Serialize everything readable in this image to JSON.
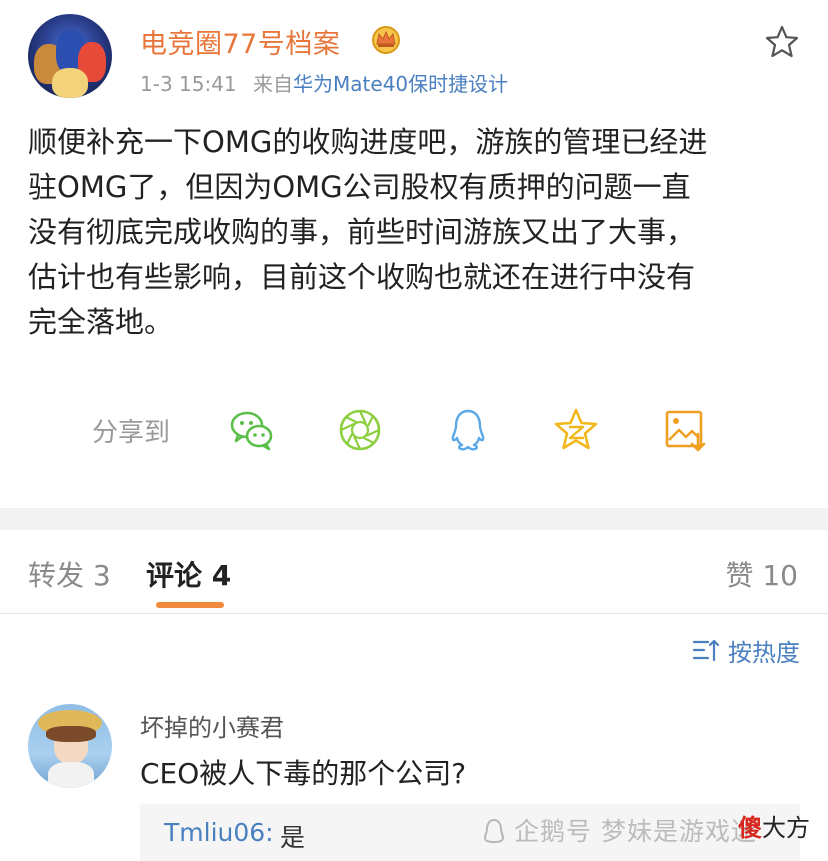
{
  "post": {
    "username": "电竞圈77号档案",
    "time": "1-3 15:41",
    "from_prefix": "来自",
    "source": "华为Mate40保时捷设计",
    "content_lines": [
      "顺便补充一下OMG的收购进度吧，游族的管理已经进",
      "驻OMG了，但因为OMG公司股权有质押的问题一直",
      "没有彻底完成收购的事，前些时间游族又出了大事，",
      "估计也有些影响，目前这个收购也就还在进行中没有",
      "完全落地。"
    ]
  },
  "share": {
    "label": "分享到",
    "icons": [
      "wechat-icon",
      "moments-icon",
      "qq-icon",
      "qzone-icon",
      "save-image-icon"
    ]
  },
  "tabs": {
    "repost": "转发 3",
    "comment": "评论 4",
    "like": "赞 10"
  },
  "sort": {
    "label": "按热度"
  },
  "comment": {
    "user": "坏掉的小赛君",
    "text": "CEO被人下毒的那个公司?",
    "reply_user": "Tmliu06:",
    "reply_text": "是"
  },
  "watermark": {
    "text": "企鹅号 梦妹是游戏迷",
    "corner_red": "傻",
    "corner_black": "大方"
  },
  "colors": {
    "username": "#e8763a",
    "link": "#4a7fc0",
    "wechat": "#5bbf4a",
    "moments": "#8ccf3f",
    "qq": "#5aa8e8",
    "qzone": "#f2b81b",
    "save": "#f0a020",
    "accent_underline": "#f08a3c"
  }
}
